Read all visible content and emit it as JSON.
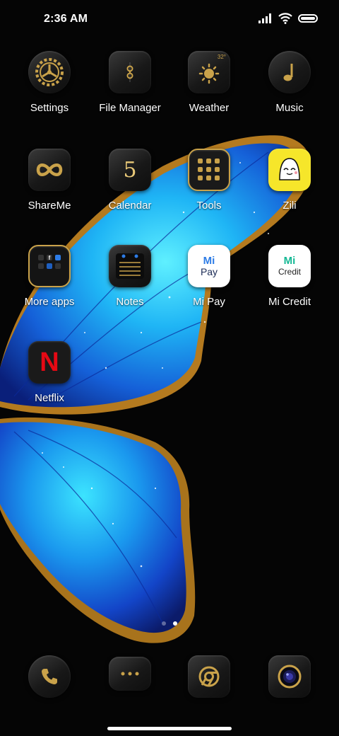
{
  "status_bar": {
    "time": "2:36 AM",
    "icons": [
      "cellular-signal-icon",
      "wifi-icon",
      "battery-icon"
    ],
    "battery_level": 1.0
  },
  "apps": [
    {
      "label": "Settings",
      "icon": "settings-gear-icon"
    },
    {
      "label": "File Manager",
      "icon": "file-manager-icon"
    },
    {
      "label": "Weather",
      "icon": "weather-sun-icon",
      "badge": "32°"
    },
    {
      "label": "Music",
      "icon": "music-note-icon"
    },
    {
      "label": "ShareMe",
      "icon": "shareme-infinity-icon"
    },
    {
      "label": "Calendar",
      "icon": "calendar-icon",
      "badge": "5"
    },
    {
      "label": "Tools",
      "icon": "tools-folder-icon"
    },
    {
      "label": "Zili",
      "icon": "zili-icon"
    },
    {
      "label": "More apps",
      "icon": "more-apps-folder-icon"
    },
    {
      "label": "Notes",
      "icon": "notes-icon"
    },
    {
      "label": "Mi Pay",
      "icon": "mi-pay-icon",
      "logo_text": [
        "Mi",
        "Pay"
      ]
    },
    {
      "label": "Mi Credit",
      "icon": "mi-credit-icon",
      "logo_text": [
        "Mi",
        "Credit"
      ]
    },
    {
      "label": "Netflix",
      "icon": "netflix-icon",
      "logo_text": [
        "N"
      ]
    }
  ],
  "page_indicator": {
    "pages": 2,
    "current": 2
  },
  "dock": [
    {
      "icon": "phone-icon"
    },
    {
      "icon": "messages-icon"
    },
    {
      "icon": "chrome-browser-icon"
    },
    {
      "icon": "camera-icon"
    }
  ],
  "colors": {
    "gold": "#c9a24a",
    "wing_blue": "#1ea7f0",
    "background": "#050505",
    "netflix_red": "#e50914",
    "mi_teal": "#14b894",
    "mi_pay_blue": "#2d7ce6",
    "zili_yellow": "#f6e62a"
  }
}
